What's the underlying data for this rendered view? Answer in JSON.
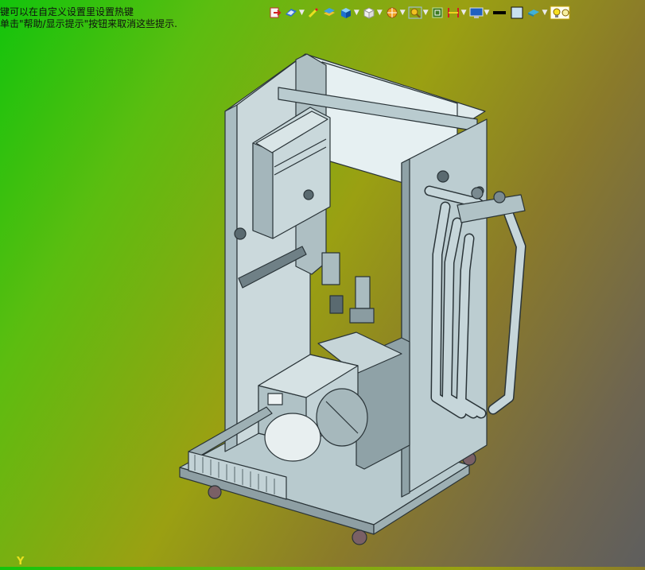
{
  "hint": {
    "line1": "键可以在自定义设置里设置热键",
    "line2": "单击\"帮助/显示提示\"按钮来取消这些提示."
  },
  "toolbar": {
    "buttons": [
      {
        "id": "save",
        "icon": "save-icon"
      },
      {
        "id": "view-orient",
        "icon": "view-orientation-icon"
      },
      {
        "id": "sketch",
        "icon": "pencil-icon"
      },
      {
        "id": "layer",
        "icon": "layer-icon"
      },
      {
        "id": "solid",
        "icon": "solid-cube-icon"
      },
      {
        "id": "wire",
        "icon": "wireframe-cube-icon"
      },
      {
        "id": "section",
        "icon": "section-view-icon"
      },
      {
        "id": "zoom",
        "icon": "zoom-icon"
      },
      {
        "id": "fit",
        "icon": "fit-view-icon"
      },
      {
        "id": "measure",
        "icon": "measure-icon"
      },
      {
        "id": "display",
        "icon": "display-monitor-icon"
      },
      {
        "id": "line",
        "icon": "line-style-icon"
      },
      {
        "id": "color",
        "icon": "color-swatch-icon"
      },
      {
        "id": "material",
        "icon": "material-icon"
      },
      {
        "id": "light",
        "icon": "light-bulb-icon"
      }
    ]
  },
  "viewport": {
    "axis_label": "Y",
    "model_colors": {
      "body": "#c2d2d6",
      "dark": "#5a6a70",
      "line": "#2a3438",
      "frame": "#b4c6ca"
    }
  }
}
